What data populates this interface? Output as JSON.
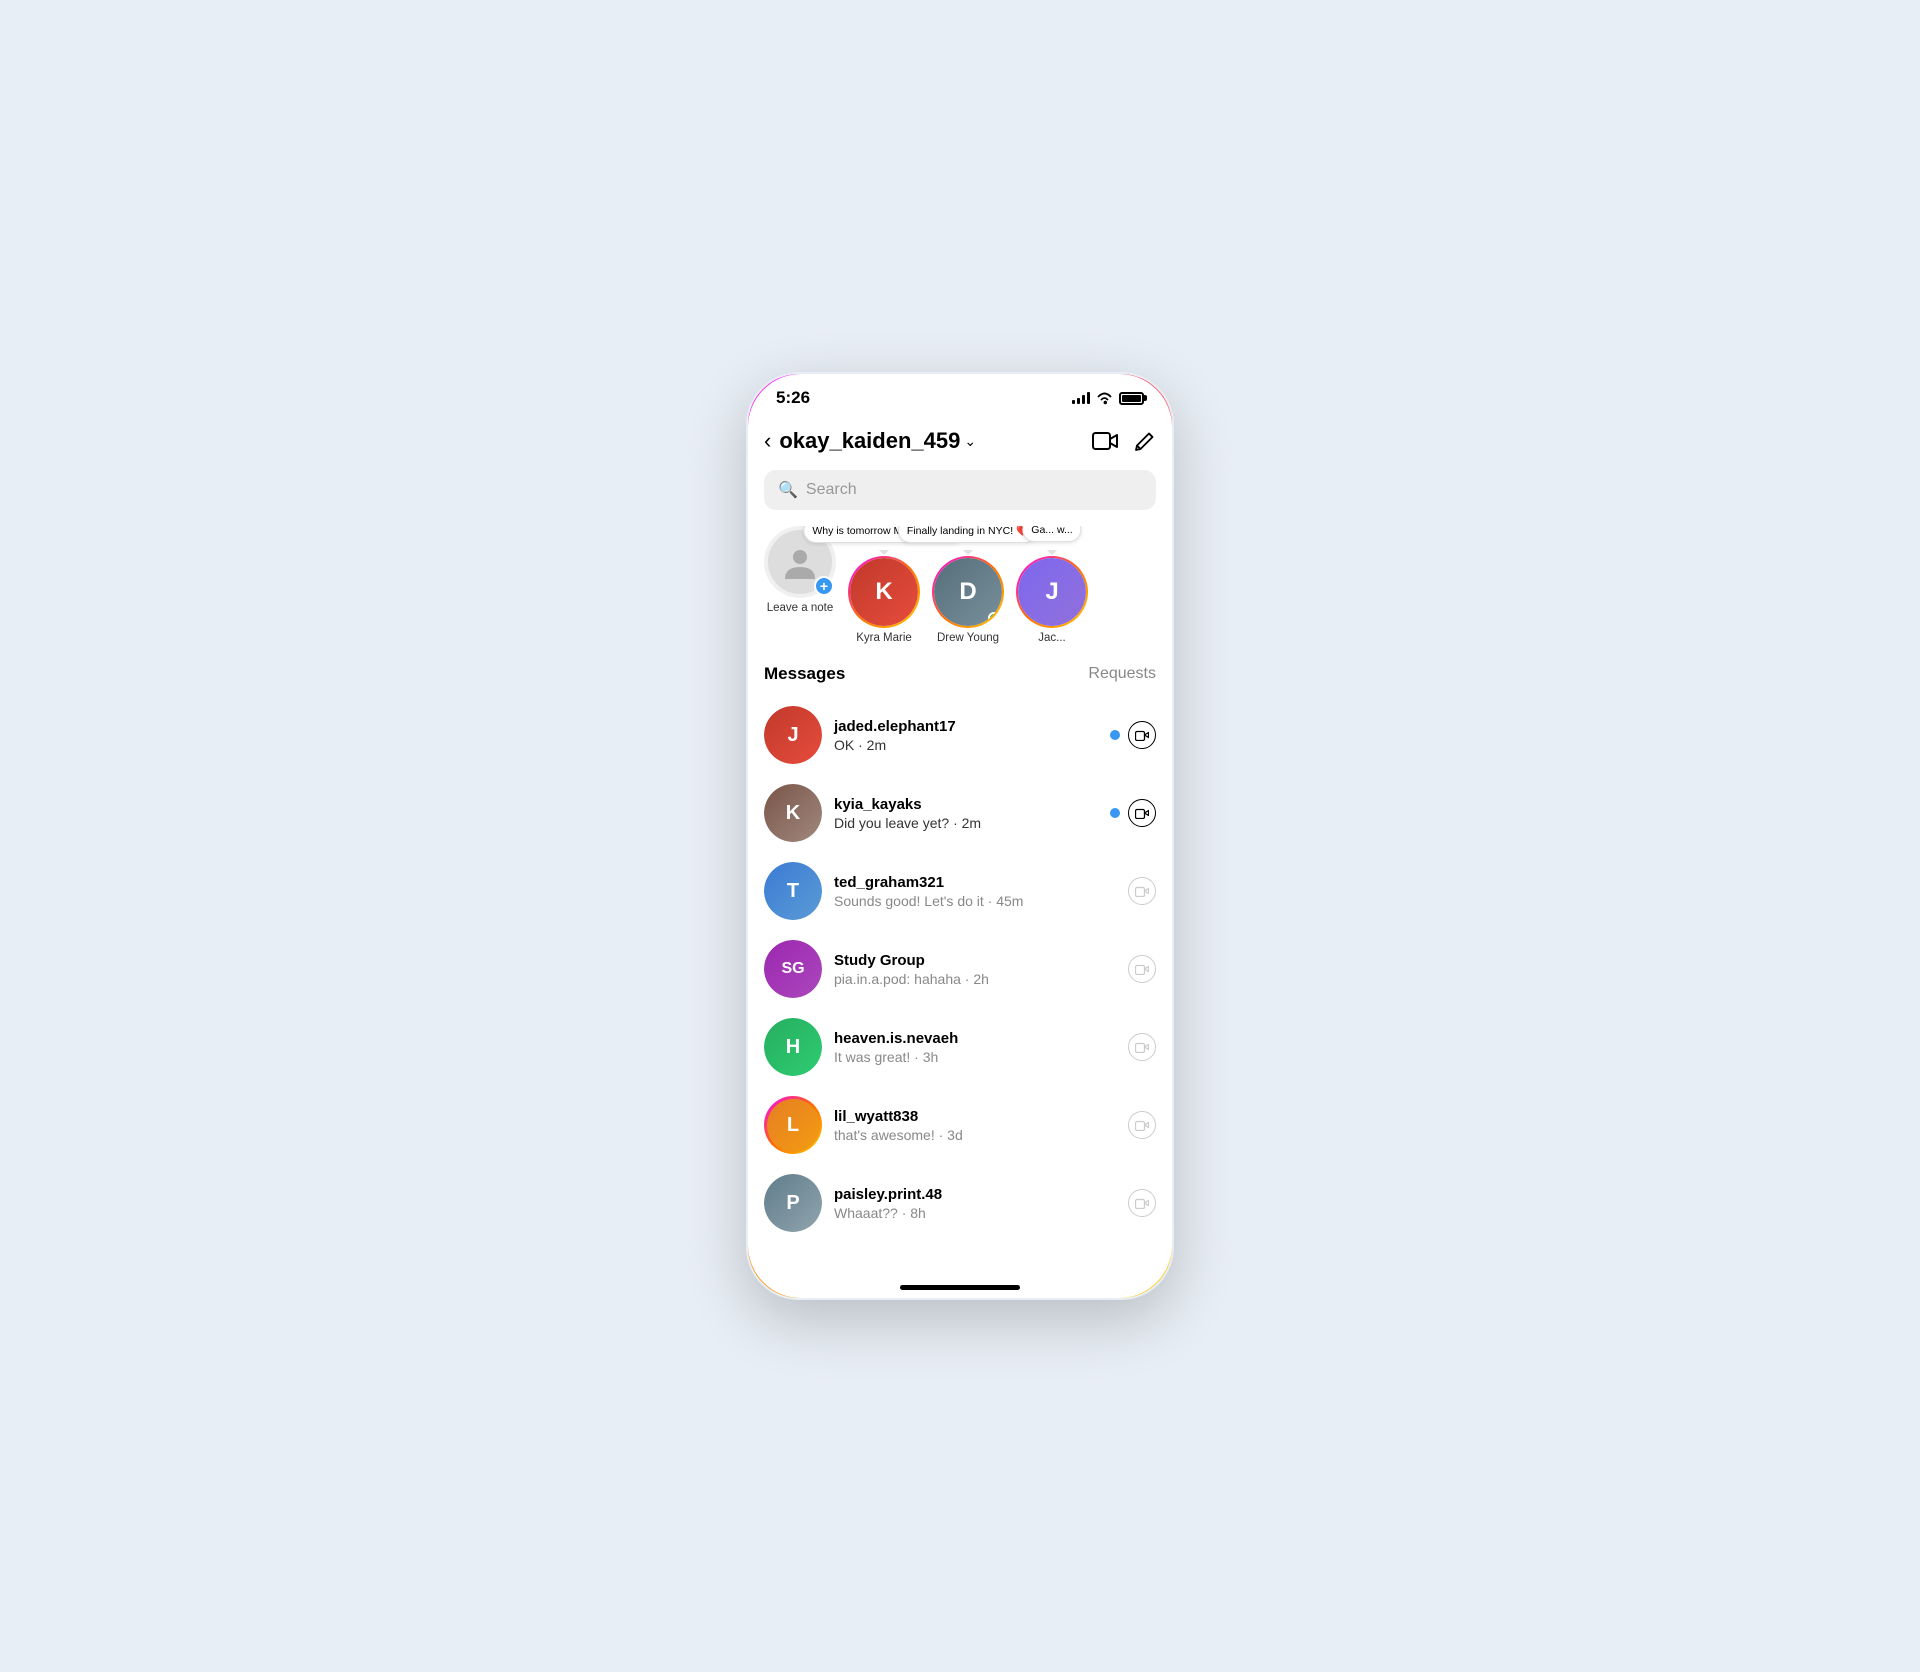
{
  "status": {
    "time": "5:26"
  },
  "header": {
    "back_label": "‹",
    "username": "okay_kaiden_459",
    "chevron": "⌄"
  },
  "search": {
    "placeholder": "Search"
  },
  "notes": [
    {
      "id": "self",
      "label": "Leave a note",
      "has_bubble": false,
      "note_text": "",
      "has_active": false
    },
    {
      "id": "kyra",
      "label": "Kyra Marie",
      "has_bubble": true,
      "note_text": "Why is tomorrow Monday!? 😩",
      "has_active": false,
      "color": "#c0392b"
    },
    {
      "id": "drew",
      "label": "Drew Young",
      "has_bubble": true,
      "note_text": "Finally landing in NYC! ❤️",
      "has_active": true,
      "color": "#555"
    },
    {
      "id": "jac",
      "label": "Jac...",
      "has_bubble": true,
      "note_text": "Ga... w...",
      "has_active": false,
      "color": "#7b68ee"
    }
  ],
  "messages_title": "Messages",
  "requests_label": "Requests",
  "messages": [
    {
      "id": "jaded",
      "username": "jaded.elephant17",
      "preview": "OK · 2m",
      "unread": true,
      "color": "#e74c3c",
      "initial": "J",
      "camera_active": true
    },
    {
      "id": "kyia",
      "username": "kyia_kayaks",
      "preview": "Did you leave yet? · 2m",
      "unread": true,
      "color": "#795548",
      "initial": "K",
      "camera_active": true
    },
    {
      "id": "ted",
      "username": "ted_graham321",
      "preview": "Sounds good! Let's do it · 45m",
      "unread": false,
      "color": "#4a90d9",
      "initial": "T",
      "camera_active": false
    },
    {
      "id": "studygroup",
      "username": "Study Group",
      "preview": "pia.in.a.pod: hahaha · 2h",
      "unread": false,
      "color": "#9c27b0",
      "initial": "S",
      "camera_active": false
    },
    {
      "id": "heaven",
      "username": "heaven.is.nevaeh",
      "preview": "It was great! · 3h",
      "unread": false,
      "color": "#27ae60",
      "initial": "H",
      "camera_active": false
    },
    {
      "id": "lil_wyatt",
      "username": "lil_wyatt838",
      "preview": "that's awesome! · 3d",
      "unread": false,
      "color": "#e67e22",
      "initial": "L",
      "camera_active": false,
      "has_gradient": true
    },
    {
      "id": "paisley",
      "username": "paisley.print.48",
      "preview": "Whaaat?? · 8h",
      "unread": false,
      "color": "#607d8b",
      "initial": "P",
      "camera_active": false
    }
  ]
}
